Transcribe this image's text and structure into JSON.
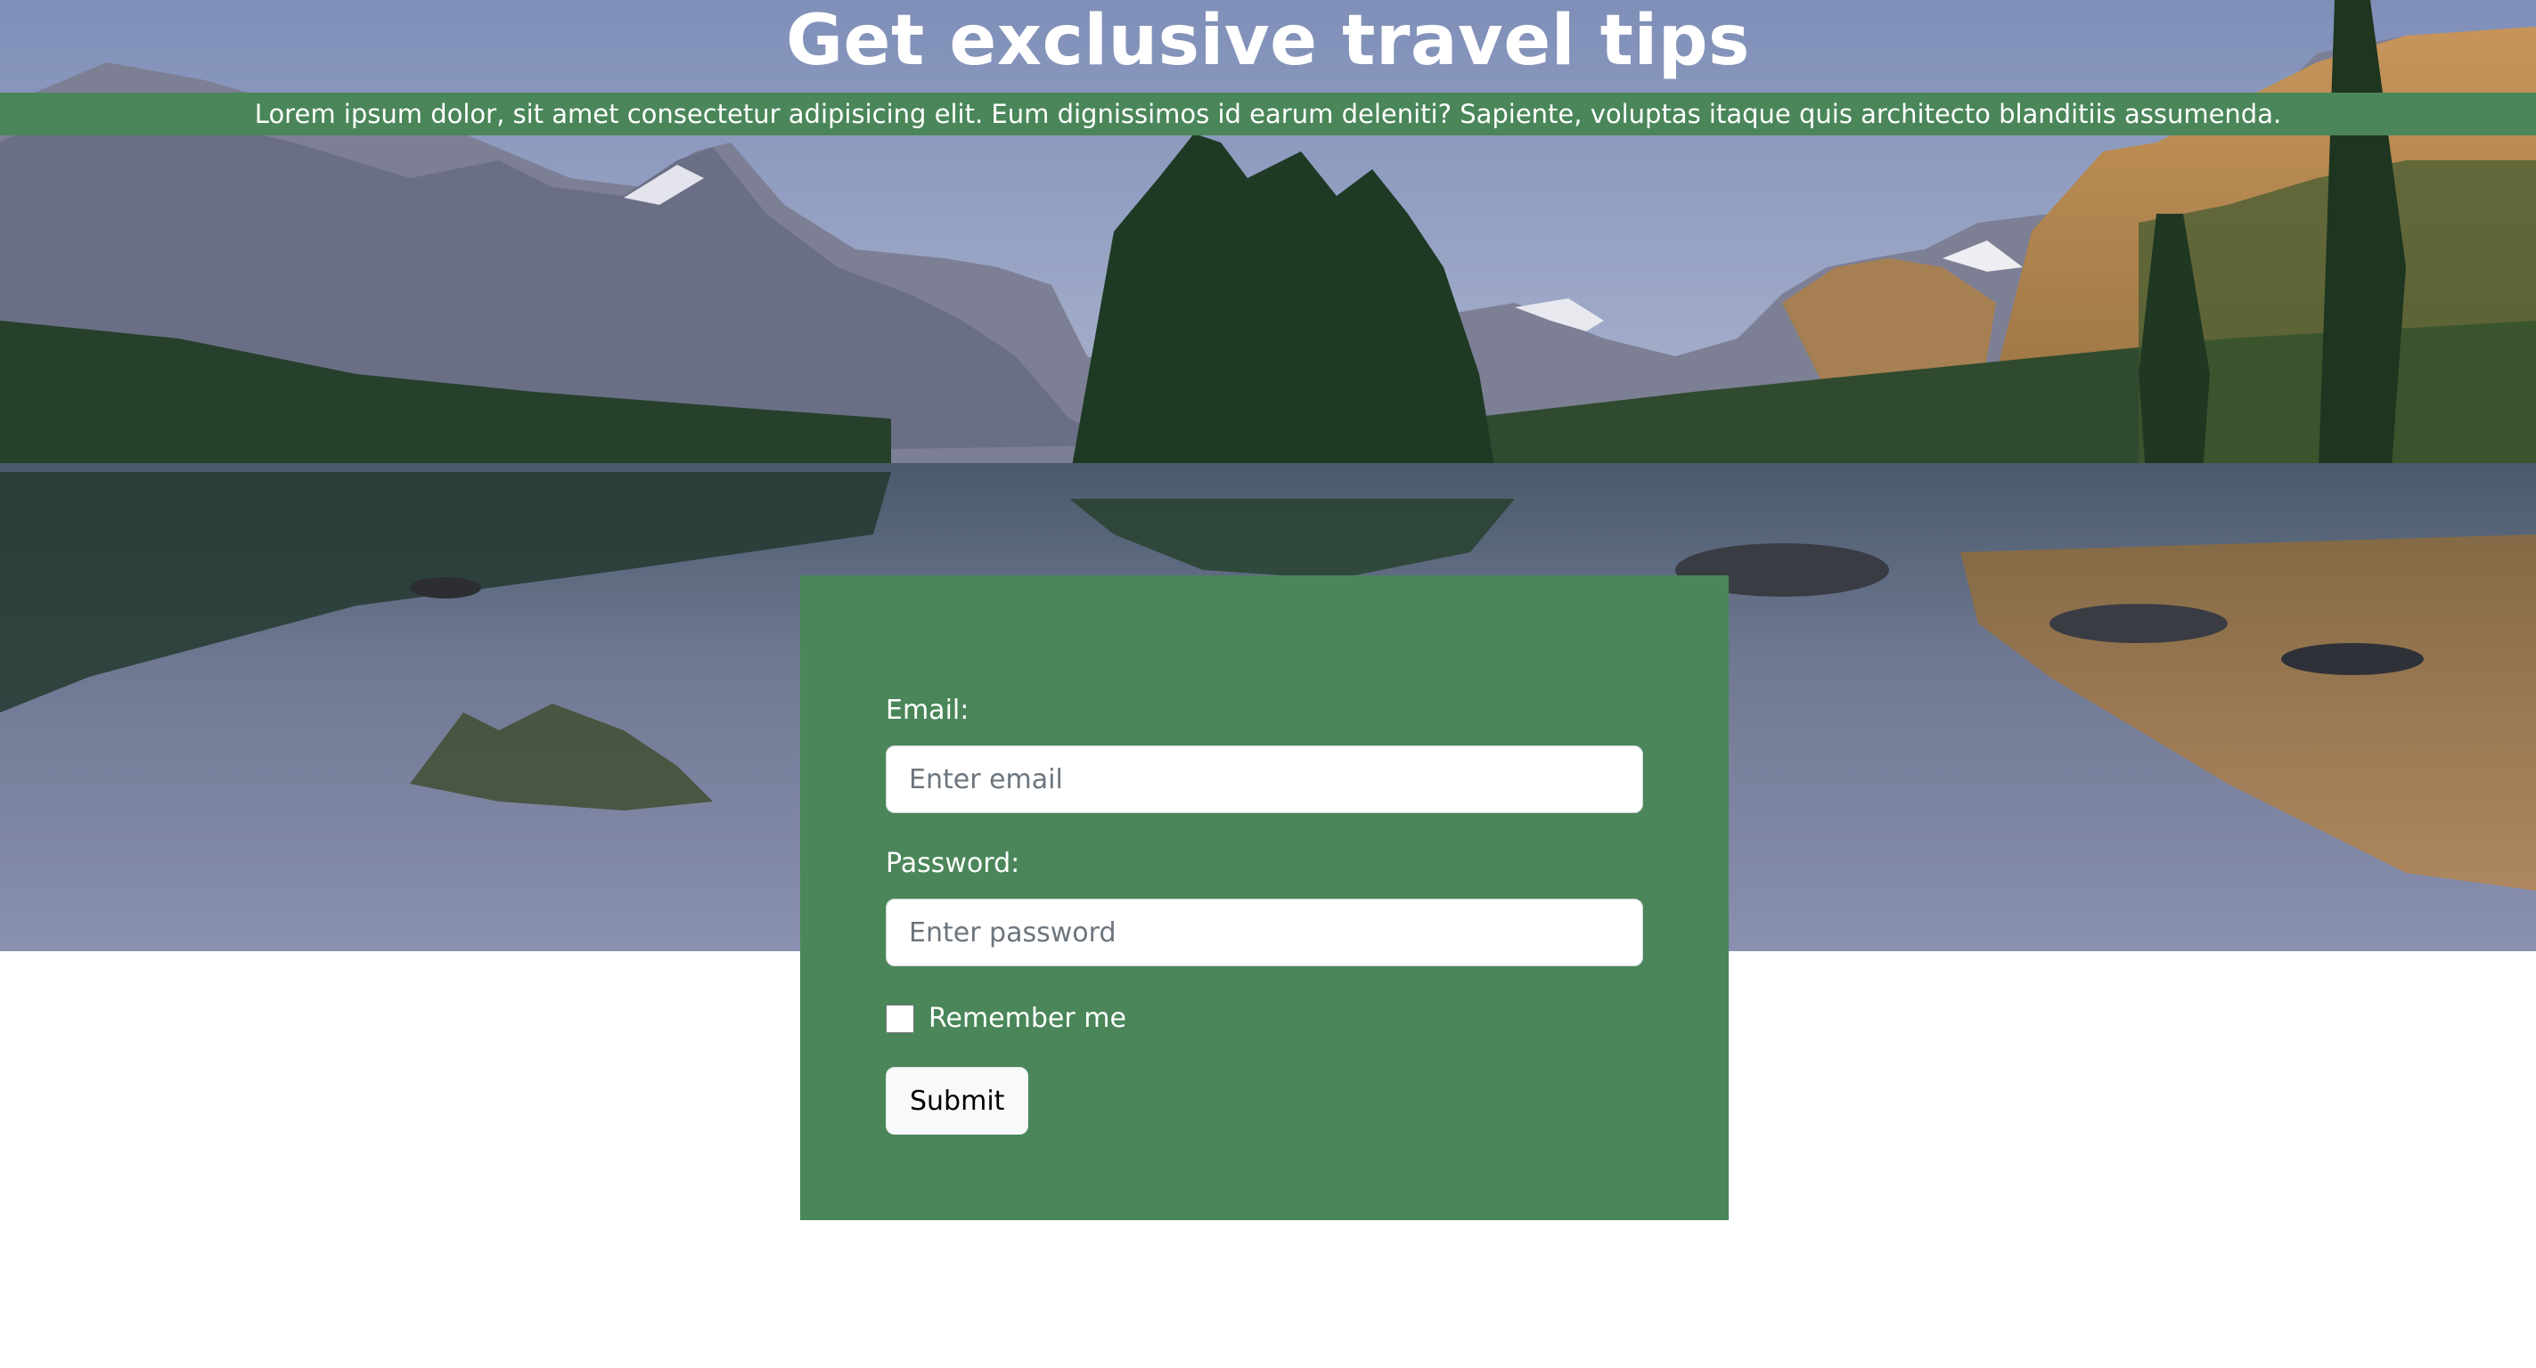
{
  "hero": {
    "title": "Get exclusive travel tips",
    "subtitle": "Lorem ipsum dolor, sit amet consectetur adipisicing elit. Eum dignissimos id earum deleniti? Sapiente, voluptas itaque quis architecto blanditiis assumenda.",
    "band_color": "#4a8659"
  },
  "form": {
    "email_label": "Email:",
    "email_placeholder": "Enter email",
    "email_value": "",
    "password_label": "Password:",
    "password_placeholder": "Enter password",
    "password_value": "",
    "remember_label": "Remember me",
    "remember_checked": false,
    "submit_label": "Submit",
    "panel_color": "#4a8659"
  }
}
